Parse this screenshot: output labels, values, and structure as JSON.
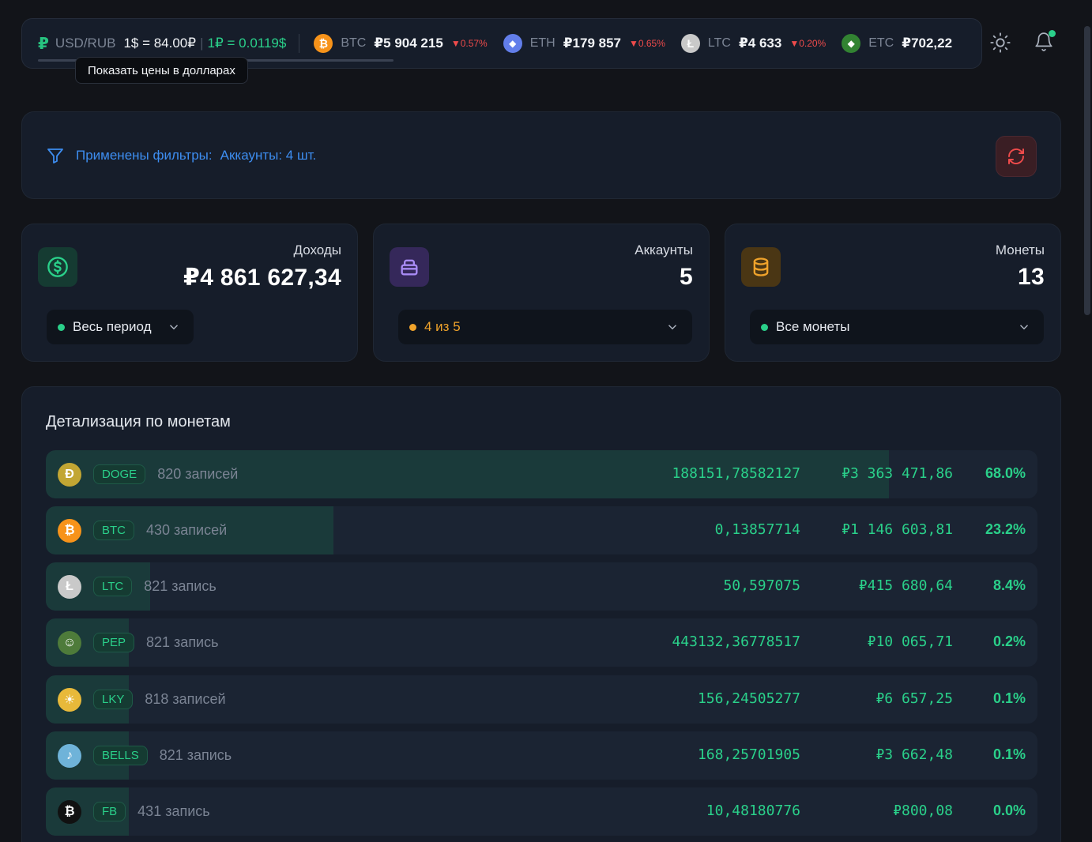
{
  "ticker": {
    "currency_label": "USD/RUB",
    "rate_usd": "1$ = 84.00₽",
    "rate_rub": "1₽ = 0.0119$",
    "coins": [
      {
        "symbol": "BTC",
        "price": "₽5 904 215",
        "change": "▼0.57%",
        "color": "#f7931a",
        "glyph": "₿"
      },
      {
        "symbol": "ETH",
        "price": "₽179 857",
        "change": "▼0.65%",
        "color": "#627eea",
        "glyph": "◆"
      },
      {
        "symbol": "LTC",
        "price": "₽4 633",
        "change": "▼0.20%",
        "color": "#c9c9c9",
        "glyph": "Ł"
      },
      {
        "symbol": "ETC",
        "price": "₽702,22",
        "change": "",
        "color": "#328332",
        "glyph": "◆"
      }
    ],
    "tooltip": "Показать цены в долларах"
  },
  "filter": {
    "label": "Применены фильтры:",
    "value": "Аккаунты: 4 шт."
  },
  "cards": {
    "income": {
      "label": "Доходы",
      "value": "₽4 861 627,34",
      "select": "Весь период"
    },
    "accounts": {
      "label": "Аккаунты",
      "value": "5",
      "select": "4 из 5"
    },
    "coins": {
      "label": "Монеты",
      "value": "13",
      "select": "Все монеты"
    }
  },
  "details": {
    "title": "Детализация по монетам",
    "rows": [
      {
        "symbol": "DOGE",
        "records": "820 записей",
        "amount": "188151,78582127",
        "rub": "₽3 363 471,86",
        "percent": "68.0%",
        "share": 0.68,
        "color": "#c2a633",
        "glyph": "Ð"
      },
      {
        "symbol": "BTC",
        "records": "430 записей",
        "amount": "0,13857714",
        "rub": "₽1 146 603,81",
        "percent": "23.2%",
        "share": 0.232,
        "color": "#f7931a",
        "glyph": "₿"
      },
      {
        "symbol": "LTC",
        "records": "821 запись",
        "amount": "50,597075",
        "rub": "₽415 680,64",
        "percent": "8.4%",
        "share": 0.084,
        "color": "#c9c9c9",
        "glyph": "Ł"
      },
      {
        "symbol": "PEP",
        "records": "821 запись",
        "amount": "443132,36778517",
        "rub": "₽10 065,71",
        "percent": "0.2%",
        "share": 0.002,
        "color": "#4e7b3a",
        "glyph": "☺"
      },
      {
        "symbol": "LKY",
        "records": "818 записей",
        "amount": "156,24505277",
        "rub": "₽6 657,25",
        "percent": "0.1%",
        "share": 0.001,
        "color": "#e8b93a",
        "glyph": "☀"
      },
      {
        "symbol": "BELLS",
        "records": "821 запись",
        "amount": "168,25701905",
        "rub": "₽3 662,48",
        "percent": "0.1%",
        "share": 0.001,
        "color": "#6fb3d9",
        "glyph": "♪"
      },
      {
        "symbol": "FB",
        "records": "431 запись",
        "amount": "10,48180776",
        "rub": "₽800,08",
        "percent": "0.0%",
        "share": 0.0,
        "color": "#111111",
        "glyph": "₿"
      }
    ]
  },
  "colors": {
    "accent": "#2ad08a",
    "danger": "#ef4b4b",
    "link": "#3d8df0",
    "background": "#121419",
    "panel": "#161d2a"
  }
}
